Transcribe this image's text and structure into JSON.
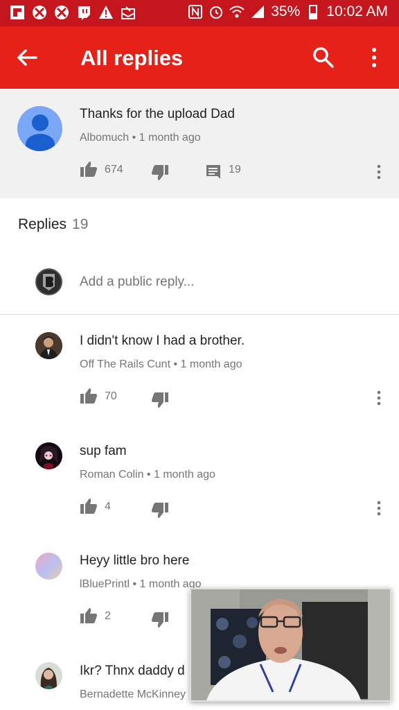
{
  "status_bar": {
    "battery": "35%",
    "time": "10:02 AM",
    "left_icons": [
      "flipboard-icon",
      "xbox-icon",
      "xbox-icon",
      "twitch-icon",
      "alert-icon",
      "mail-icon"
    ],
    "right_icons": [
      "nfc-icon",
      "alarm-icon",
      "wifi-icon",
      "signal-icon",
      "battery-icon"
    ]
  },
  "app_bar": {
    "title": "All replies"
  },
  "parent_comment": {
    "text": "Thanks for the upload Dad",
    "author": "Albomuch",
    "time": "1 month ago",
    "likes": "674",
    "reply_count": "19"
  },
  "replies_header": {
    "label": "Replies",
    "count": "19"
  },
  "reply_box": {
    "placeholder": "Add a public reply..."
  },
  "replies": [
    {
      "text": "I didn't know I had a brother.",
      "author": "Off The Rails Cunt",
      "time": "1 month ago",
      "likes": "70"
    },
    {
      "text": "sup fam",
      "author": "Roman Colin",
      "time": "1 month ago",
      "likes": "4"
    },
    {
      "text": "Heyy little bro here",
      "author": "lBluePrintl",
      "time": "1 month ago",
      "likes": "2"
    },
    {
      "text": "Ikr?  Thnx daddy d",
      "author": "Bernadette McKinney",
      "time": ""
    }
  ],
  "colors": {
    "status_bar": "#c4161c",
    "app_bar": "#e62117",
    "parent_bg": "#f1f1f1",
    "icon_gray": "#757575"
  }
}
